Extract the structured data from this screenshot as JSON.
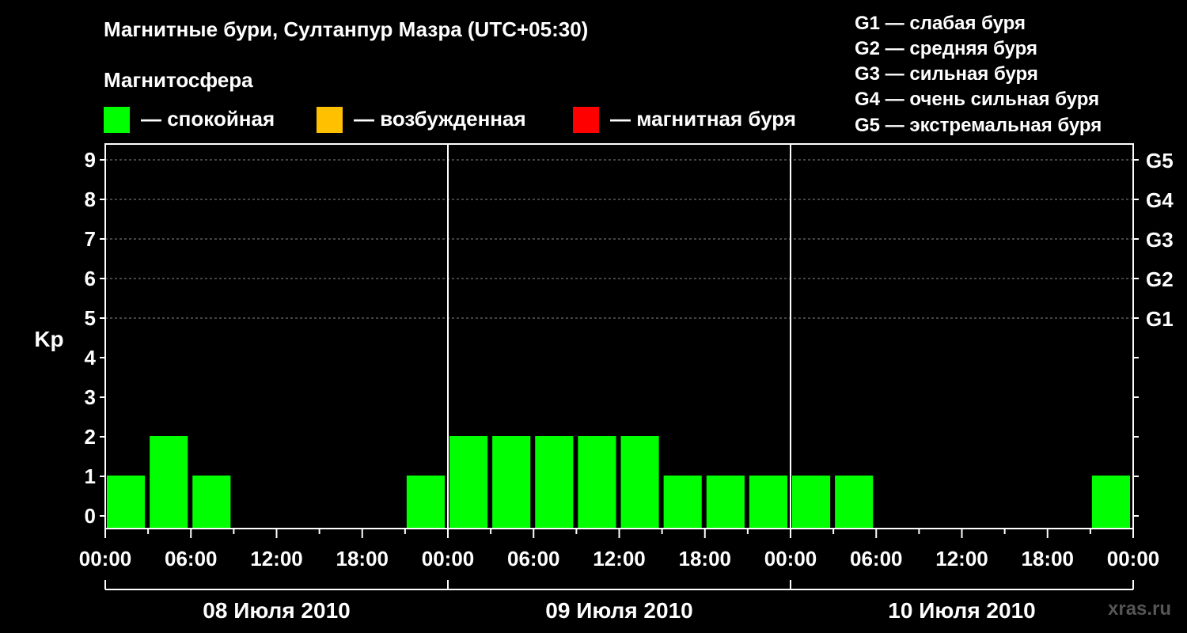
{
  "title": "Магнитные бури, Султанпур Мазра (UTC+05:30)",
  "subtitle": "Магнитосфера",
  "legend": [
    {
      "color": "#00ff00",
      "label": "— спокойная"
    },
    {
      "color": "#ffc000",
      "label": "— возбужденная"
    },
    {
      "color": "#ff0000",
      "label": "— магнитная буря"
    }
  ],
  "g_scale": [
    "G1 — слабая буря",
    "G2 — средняя буря",
    "G3 — сильная буря",
    "G4 — очень сильная буря",
    "G5 — экстремальная буря"
  ],
  "watermark": "xras.ru",
  "chart_data": {
    "type": "bar",
    "ylabel": "Kp",
    "ylim": [
      0,
      9
    ],
    "y_ticks": [
      "0",
      "1",
      "2",
      "3",
      "4",
      "5",
      "6",
      "7",
      "8",
      "9"
    ],
    "right_ticks": [
      {
        "value": 5,
        "label": "G1"
      },
      {
        "value": 6,
        "label": "G2"
      },
      {
        "value": 7,
        "label": "G3"
      },
      {
        "value": 8,
        "label": "G4"
      },
      {
        "value": 9,
        "label": "G5"
      }
    ],
    "x_tick_labels": [
      "00:00",
      "06:00",
      "12:00",
      "18:00",
      "00:00",
      "06:00",
      "12:00",
      "18:00",
      "00:00",
      "06:00",
      "12:00",
      "18:00",
      "00:00"
    ],
    "days": [
      "08 Июля 2010",
      "09 Июля 2010",
      "10 Июля 2010"
    ],
    "interval_hours": 3,
    "colors": {
      "quiet": "#00ff00"
    },
    "values": [
      1,
      2,
      1,
      null,
      null,
      null,
      null,
      1,
      2,
      2,
      2,
      2,
      2,
      1,
      1,
      1,
      1,
      1,
      null,
      null,
      null,
      null,
      null,
      1
    ]
  }
}
